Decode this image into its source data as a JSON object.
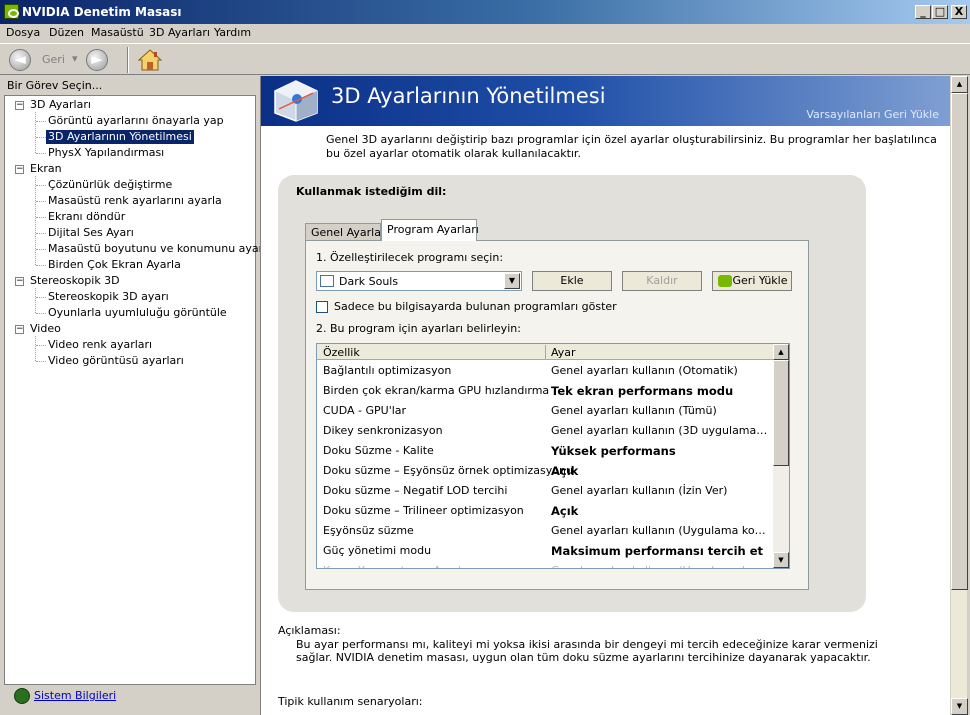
{
  "window": {
    "title": "NVIDIA Denetim Masası",
    "minimize": "_",
    "maximize": "□",
    "close": "X"
  },
  "menu": [
    "Dosya",
    "Düzen",
    "Masaüstü",
    "3D Ayarları",
    "Yardım"
  ],
  "toolbar": {
    "back_label": "Geri",
    "back_arrow": "◄",
    "forward_arrow": "►",
    "dropdown": "▾"
  },
  "sidebar": {
    "header": "Bir Görev Seçin...",
    "groups": [
      {
        "label": "3D Ayarları",
        "items": [
          "Görüntü ayarlarını önayarla yap",
          "3D Ayarlarının Yönetilmesi",
          "PhysX Yapılandırması"
        ]
      },
      {
        "label": "Ekran",
        "items": [
          "Çözünürlük değiştirme",
          "Masaüstü renk ayarlarını ayarla",
          "Ekranı döndür",
          "Dijital Ses Ayarı",
          "Masaüstü boyutunu ve konumunu ayarla",
          "Birden Çok Ekran Ayarla"
        ]
      },
      {
        "label": "Stereoskopik 3D",
        "items": [
          "Stereoskopik 3D ayarı",
          "Oyunlarla uyumluluğu görüntüle"
        ]
      },
      {
        "label": "Video",
        "items": [
          "Video renk ayarları",
          "Video görüntüsü ayarları"
        ]
      }
    ],
    "expander": "−",
    "system_info": "Sistem Bilgileri"
  },
  "main": {
    "title": "3D Ayarlarının Yönetilmesi",
    "restore_defaults": "Varsayılanları Geri Yükle",
    "intro": "Genel 3D ayarlarını değiştirip bazı programlar için özel ayarlar oluşturabilirsiniz. Bu programlar her başlatılınca bu özel ayarlar otomatik olarak kullanılacaktır.",
    "panel_label": "Kullanmak istediğim dil:",
    "tabs": [
      "Genel Ayarlar",
      "Program Ayarları"
    ],
    "step1": "1. Özelleştirilecek programı seçin:",
    "program": "Dark Souls",
    "combo_arrow": "▼",
    "add": "Ekle",
    "remove": "Kaldır",
    "restore": "Geri Yükle",
    "only_local": "Sadece bu bilgisayarda bulunan programları göster",
    "step2": "2. Bu program için ayarları belirleyin:",
    "col_feature": "Özellik",
    "col_setting": "Ayar",
    "scroll_up": "▲",
    "scroll_down": "▼",
    "rows": [
      {
        "feature": "Bağlantılı optimizasyon",
        "setting": "Genel ayarları kullanın (Otomatik)"
      },
      {
        "feature": "Birden çok ekran/karma GPU hızlandırma",
        "setting": "Tek  ekran performans modu"
      },
      {
        "feature": "CUDA - GPU'lar",
        "setting": "Genel ayarları kullanın (Tümü)"
      },
      {
        "feature": "Dikey senkronizasyon",
        "setting": "Genel ayarları kullanın (3D uygulama ayarl..."
      },
      {
        "feature": "Doku Süzme - Kalite",
        "setting": "Yüksek performans"
      },
      {
        "feature": "Doku süzme – Eşyönsüz örnek optimizasyonu",
        "setting": "Açık"
      },
      {
        "feature": "Doku süzme – Negatif LOD tercihi",
        "setting": "Genel ayarları kullanın (İzin Ver)"
      },
      {
        "feature": "Doku süzme – Trilineer optimizasyon",
        "setting": "Açık"
      },
      {
        "feature": "Eşyönsüz süzme",
        "setting": "Genel ayarları kullanın (Uygulama kontrolü..."
      },
      {
        "feature": "Güç yönetimi modu",
        "setting": "Maksimum performansı tercih et"
      },
      {
        "feature": "Kenar Yumuşatma - Ayarlar",
        "setting": "Genel ayarları kullanın (Uygulama kontrolü)"
      }
    ],
    "description_label": "Açıklaması:",
    "description": "Bu ayar performansı mı, kaliteyi mi yoksa ikisi arasında bir dengeyi mi tercih edeceğinize karar vermenizi sağlar. NVIDIA denetim masası, uygun olan tüm doku süzme ayarlarını tercihinize dayanarak yapacaktır.",
    "typical_label": "Tipik kullanım senaryoları:"
  }
}
